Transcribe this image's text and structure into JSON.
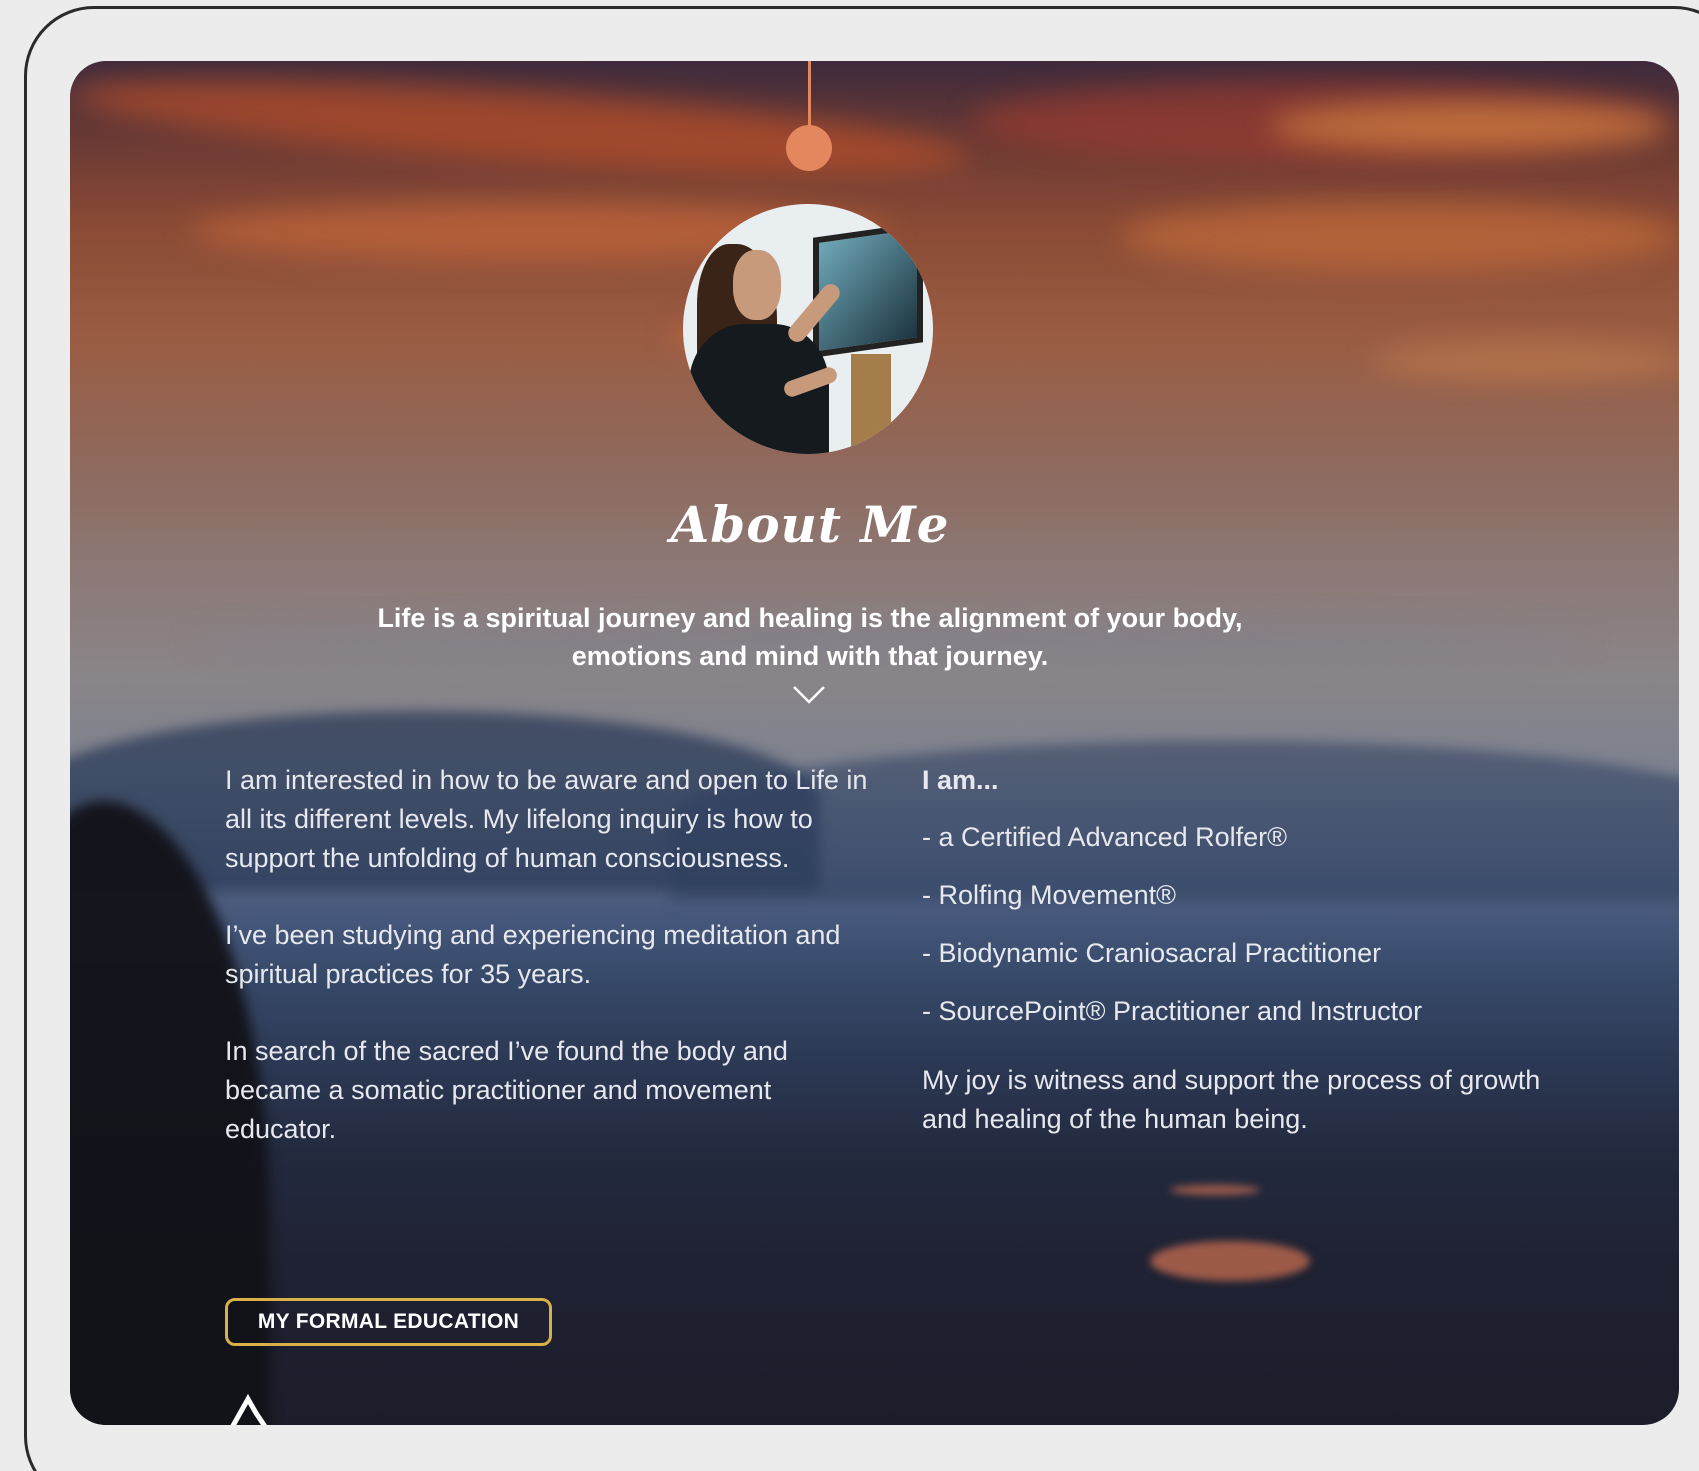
{
  "page": {
    "title": "About Me",
    "tagline": "Life is a spiritual journey and healing is the alignment of your body, emotions and mind with that journey.",
    "accent_color": "#e3875f",
    "button_border_color": "#d9b04a"
  },
  "left_column": {
    "paragraphs": [
      "I am interested in how to be aware and open to Life in all its different levels. My lifelong inquiry is how to support the unfolding of human consciousness.",
      "I’ve been studying and experiencing meditation and spiritual practices for 35 years.",
      "In search of the sacred I’ve found the body and became a somatic practitioner and movement educator."
    ],
    "button_label": "MY FORMAL EDUCATION"
  },
  "right_column": {
    "heading": "I am...",
    "credentials": [
      "- a Certified Advanced  Rolfer®",
      "- Rolfing Movement®",
      "- Biodynamic Craniosacral Practitioner",
      "- SourcePoint® Practitioner and Instructor"
    ],
    "closing": "My joy is witness and support the process of growth and healing of the human being."
  },
  "icons": {
    "chevron": "chevron-down-icon"
  }
}
